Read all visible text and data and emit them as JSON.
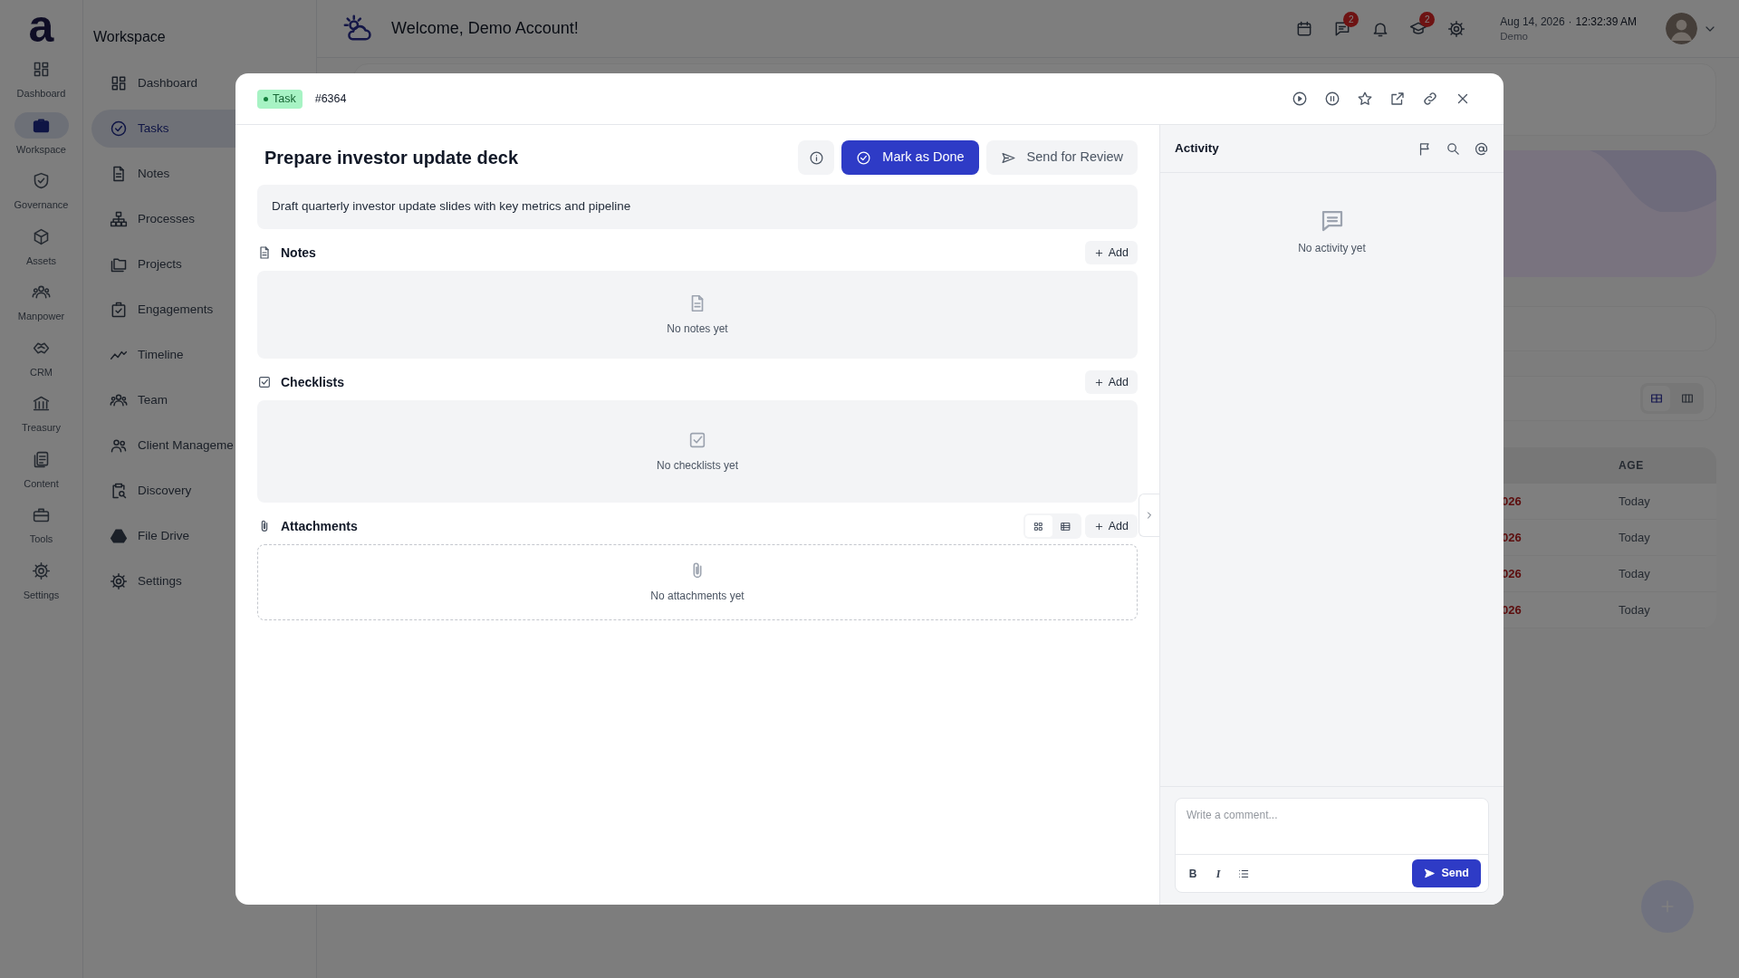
{
  "rail": {
    "logo": "a",
    "items": [
      {
        "label": "Dashboard",
        "selected": false
      },
      {
        "label": "Workspace",
        "selected": true
      },
      {
        "label": "Governance",
        "selected": false
      },
      {
        "label": "Assets",
        "selected": false
      },
      {
        "label": "Manpower",
        "selected": false
      },
      {
        "label": "CRM",
        "selected": false
      },
      {
        "label": "Treasury",
        "selected": false
      },
      {
        "label": "Content",
        "selected": false
      },
      {
        "label": "Tools",
        "selected": false
      },
      {
        "label": "Settings",
        "selected": false
      }
    ]
  },
  "sidebar": {
    "title": "Workspace",
    "items": [
      {
        "label": "Dashboard",
        "selected": false
      },
      {
        "label": "Tasks",
        "selected": true
      },
      {
        "label": "Notes",
        "selected": false
      },
      {
        "label": "Processes",
        "selected": false
      },
      {
        "label": "Projects",
        "selected": false
      },
      {
        "label": "Engagements",
        "selected": false
      },
      {
        "label": "Timeline",
        "selected": false
      },
      {
        "label": "Team",
        "selected": false
      },
      {
        "label": "Client Manageme",
        "selected": false
      },
      {
        "label": "Discovery",
        "selected": false
      },
      {
        "label": "File Drive",
        "selected": false
      },
      {
        "label": "Settings",
        "selected": false
      }
    ]
  },
  "topbar": {
    "title": "Welcome, Demo Account!",
    "actions": [
      {
        "kind": "calendar"
      },
      {
        "kind": "chat",
        "badge": "2"
      },
      {
        "kind": "bell"
      },
      {
        "kind": "cap",
        "badge": "2"
      },
      {
        "kind": "gear"
      }
    ],
    "date": "Aug 14, 2026",
    "separator": "·",
    "time": "12:32:39 AM",
    "user": "Demo"
  },
  "background": {
    "view_toggle": [
      {
        "selected": true
      },
      {
        "selected": false
      }
    ],
    "table": {
      "columns": [
        "AGE"
      ],
      "rows": [
        {
          "column_1": "026",
          "age": "Today"
        },
        {
          "column_1": "026",
          "age": "Today"
        },
        {
          "column_1": "026",
          "age": "Today"
        },
        {
          "column_1": "026",
          "age": "Today"
        }
      ]
    }
  },
  "modal": {
    "badge": "Task",
    "id": "#6364",
    "title": "Prepare investor update deck",
    "description": "Draft quarterly investor update slides with key metrics and pipeline",
    "primary_button": "Mark as Done",
    "secondary_button": "Send for Review",
    "sections": [
      {
        "kind": "notes",
        "title": "Notes",
        "add": "Add",
        "empty": "No notes yet"
      },
      {
        "kind": "checklists",
        "title": "Checklists",
        "add": "Add",
        "empty": "No checklists yet"
      },
      {
        "kind": "attachments",
        "title": "Attachments",
        "add": "Add",
        "empty": "No attachments yet",
        "view_toggle": [
          {
            "selected": true
          },
          {
            "selected": false
          }
        ]
      }
    ],
    "activity": {
      "title": "Activity",
      "empty": "No activity yet",
      "comment_placeholder": "Write a comment...",
      "format_buttons": [
        "B",
        "I"
      ],
      "send": "Send"
    }
  }
}
